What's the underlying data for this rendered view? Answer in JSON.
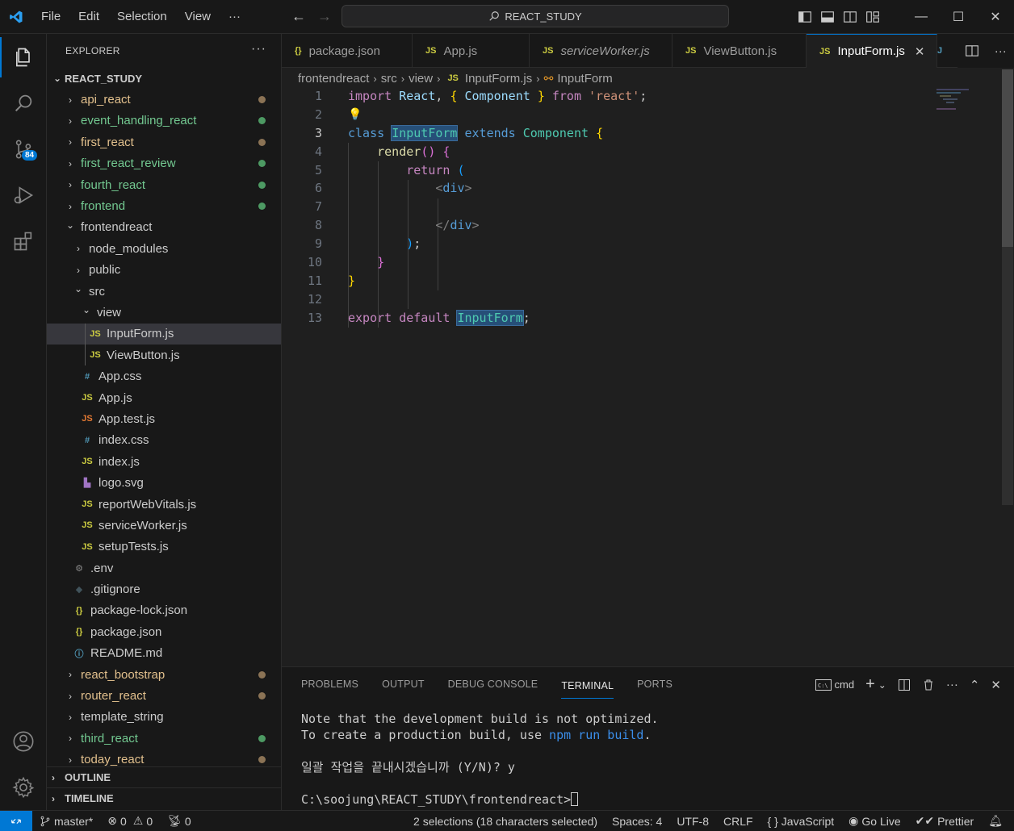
{
  "titlebar": {
    "menu": [
      "File",
      "Edit",
      "Selection",
      "View"
    ],
    "more": "···",
    "search": "REACT_STUDY"
  },
  "activitybar": {
    "scm_badge": "84"
  },
  "explorer": {
    "title": "EXPLORER",
    "root": "REACT_STUDY",
    "items": [
      {
        "label": "api_react",
        "level": 0,
        "type": "folder",
        "open": false,
        "dot": "#8b7355",
        "color": "#e2c08d"
      },
      {
        "label": "event_handling_react",
        "level": 0,
        "type": "folder",
        "open": false,
        "dot": "#4d9a63",
        "color": "#73c991"
      },
      {
        "label": "first_react",
        "level": 0,
        "type": "folder",
        "open": false,
        "dot": "#8b7355",
        "color": "#e2c08d"
      },
      {
        "label": "first_react_review",
        "level": 0,
        "type": "folder",
        "open": false,
        "dot": "#4d9a63",
        "color": "#73c991"
      },
      {
        "label": "fourth_react",
        "level": 0,
        "type": "folder",
        "open": false,
        "dot": "#4d9a63",
        "color": "#73c991"
      },
      {
        "label": "frontend",
        "level": 0,
        "type": "folder",
        "open": false,
        "dot": "#4d9a63",
        "color": "#73c991"
      },
      {
        "label": "frontendreact",
        "level": 0,
        "type": "folder",
        "open": true,
        "dot": "",
        "color": "#cccccc"
      },
      {
        "label": "node_modules",
        "level": 1,
        "type": "folder",
        "open": false,
        "dot": "",
        "color": "#cccccc"
      },
      {
        "label": "public",
        "level": 1,
        "type": "folder",
        "open": false,
        "dot": "",
        "color": "#cccccc"
      },
      {
        "label": "src",
        "level": 1,
        "type": "folder",
        "open": true,
        "dot": "",
        "color": "#cccccc"
      },
      {
        "label": "view",
        "level": 2,
        "type": "folder",
        "open": true,
        "dot": "",
        "color": "#cccccc"
      },
      {
        "label": "InputForm.js",
        "level": 3,
        "type": "js",
        "icon": "JS",
        "icon_color": "#cbcb41",
        "dot": "",
        "color": "#cccccc",
        "selected": true
      },
      {
        "label": "ViewButton.js",
        "level": 3,
        "type": "js",
        "icon": "JS",
        "icon_color": "#cbcb41",
        "dot": "",
        "color": "#cccccc"
      },
      {
        "label": "App.css",
        "level": 2,
        "type": "css",
        "icon": "#",
        "icon_color": "#519aba",
        "dot": "",
        "color": "#cccccc"
      },
      {
        "label": "App.js",
        "level": 2,
        "type": "js",
        "icon": "JS",
        "icon_color": "#cbcb41",
        "dot": "",
        "color": "#cccccc"
      },
      {
        "label": "App.test.js",
        "level": 2,
        "type": "js",
        "icon": "JS",
        "icon_color": "#e37933",
        "dot": "",
        "color": "#cccccc"
      },
      {
        "label": "index.css",
        "level": 2,
        "type": "css",
        "icon": "#",
        "icon_color": "#519aba",
        "dot": "",
        "color": "#cccccc"
      },
      {
        "label": "index.js",
        "level": 2,
        "type": "js",
        "icon": "JS",
        "icon_color": "#cbcb41",
        "dot": "",
        "color": "#cccccc"
      },
      {
        "label": "logo.svg",
        "level": 2,
        "type": "svg",
        "icon": "▙",
        "icon_color": "#a074c4",
        "dot": "",
        "color": "#cccccc"
      },
      {
        "label": "reportWebVitals.js",
        "level": 2,
        "type": "js",
        "icon": "JS",
        "icon_color": "#cbcb41",
        "dot": "",
        "color": "#cccccc"
      },
      {
        "label": "serviceWorker.js",
        "level": 2,
        "type": "js",
        "icon": "JS",
        "icon_color": "#cbcb41",
        "dot": "",
        "color": "#cccccc"
      },
      {
        "label": "setupTests.js",
        "level": 2,
        "type": "js",
        "icon": "JS",
        "icon_color": "#cbcb41",
        "dot": "",
        "color": "#cccccc"
      },
      {
        "label": ".env",
        "level": 1,
        "type": "gear",
        "icon": "⚙",
        "icon_color": "#8a8a8a",
        "dot": "",
        "color": "#cccccc"
      },
      {
        "label": ".gitignore",
        "level": 1,
        "type": "git",
        "icon": "◆",
        "icon_color": "#41535b",
        "dot": "",
        "color": "#cccccc"
      },
      {
        "label": "package-lock.json",
        "level": 1,
        "type": "json",
        "icon": "{}",
        "icon_color": "#cbcb41",
        "dot": "",
        "color": "#cccccc"
      },
      {
        "label": "package.json",
        "level": 1,
        "type": "json",
        "icon": "{}",
        "icon_color": "#cbcb41",
        "dot": "",
        "color": "#cccccc"
      },
      {
        "label": "README.md",
        "level": 1,
        "type": "info",
        "icon": "ⓘ",
        "icon_color": "#519aba",
        "dot": "",
        "color": "#cccccc"
      },
      {
        "label": "react_bootstrap",
        "level": 0,
        "type": "folder",
        "open": false,
        "dot": "#8b7355",
        "color": "#e2c08d"
      },
      {
        "label": "router_react",
        "level": 0,
        "type": "folder",
        "open": false,
        "dot": "#8b7355",
        "color": "#e2c08d"
      },
      {
        "label": "template_string",
        "level": 0,
        "type": "folder",
        "open": false,
        "dot": "",
        "color": "#cccccc"
      },
      {
        "label": "third_react",
        "level": 0,
        "type": "folder",
        "open": false,
        "dot": "#4d9a63",
        "color": "#73c991"
      },
      {
        "label": "today_react",
        "level": 0,
        "type": "folder",
        "open": false,
        "dot": "#8b7355",
        "color": "#e2c08d"
      }
    ],
    "outline": "OUTLINE",
    "timeline": "TIMELINE"
  },
  "tabs": [
    {
      "label": "package.json",
      "icon": "{}",
      "icon_color": "#cbcb41",
      "italic": false,
      "active": false,
      "width": 162
    },
    {
      "label": "App.js",
      "icon": "JS",
      "icon_color": "#cbcb41",
      "italic": false,
      "active": false,
      "width": 145
    },
    {
      "label": "serviceWorker.js",
      "icon": "JS",
      "icon_color": "#cbcb41",
      "italic": true,
      "active": false,
      "width": 177
    },
    {
      "label": "ViewButton.js",
      "icon": "JS",
      "icon_color": "#cbcb41",
      "italic": false,
      "active": false,
      "width": 166
    },
    {
      "label": "InputForm.js",
      "icon": "JS",
      "icon_color": "#cbcb41",
      "italic": false,
      "active": true,
      "width": 162
    }
  ],
  "breadcrumb": [
    "frontendreact",
    "src",
    "view",
    "InputForm.js",
    "InputForm"
  ],
  "code": {
    "line_numbers": [
      "1",
      "2",
      "3",
      "4",
      "5",
      "6",
      "7",
      "8",
      "9",
      "10",
      "11",
      "12",
      "13"
    ],
    "current_line": "3"
  },
  "panel": {
    "tabs": [
      "PROBLEMS",
      "OUTPUT",
      "DEBUG CONSOLE",
      "TERMINAL",
      "PORTS"
    ],
    "active_tab": "TERMINAL",
    "shell": "cmd",
    "terminal": {
      "line1": "Note that the development build is not optimized.",
      "line2_pre": "To create a production build, use ",
      "line2_cmd": "npm run build",
      "line2_post": ".",
      "line3": "일괄 작업을 끝내시겠습니까 (Y/N)? y",
      "prompt": "C:\\soojung\\REACT_STUDY\\frontendreact>"
    }
  },
  "statusbar": {
    "branch": "master*",
    "errors": "0",
    "warnings": "0",
    "ports": "0",
    "selection": "2 selections (18 characters selected)",
    "spaces": "Spaces: 4",
    "encoding": "UTF-8",
    "eol": "CRLF",
    "language": "JavaScript",
    "golive": "Go Live",
    "prettier": "Prettier"
  }
}
